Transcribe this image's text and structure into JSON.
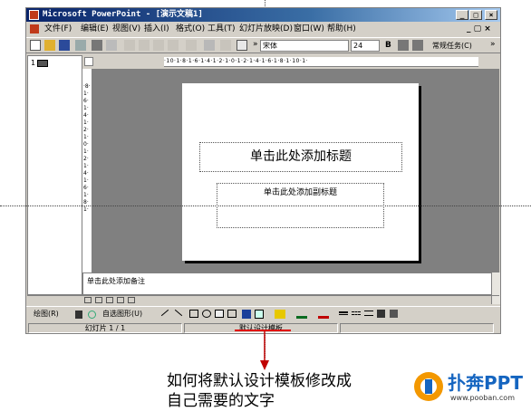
{
  "window": {
    "title": "Microsoft PowerPoint - [演示文稿1]",
    "min_label": "_",
    "max_label": "□",
    "close_label": "×"
  },
  "menu": {
    "items": [
      "文件(F)",
      "编辑(E)",
      "视图(V)",
      "插入(I)",
      "格式(O)",
      "工具(T)",
      "幻灯片放映(D)",
      "窗口(W)",
      "帮助(H)"
    ],
    "doc_controls": "_ ▢ ×"
  },
  "toolbar": {
    "font_name": "宋体",
    "font_size": "24",
    "bold_label": "B",
    "task_pane": "常规任务(C)",
    "more_label": "»"
  },
  "outline": {
    "slide_number": "1"
  },
  "ruler": {
    "horizontal": "·10·1·8·1·6·1·4·1·2·1·0·1·2·1·4·1·6·1·8·1·10·1·",
    "vertical": "·8·1·6·1·4·1·2·1·0·1·2·1·4·1·6·1·8·1·"
  },
  "slide": {
    "title_placeholder": "单击此处添加标题",
    "subtitle_placeholder": "单击此处添加副标题"
  },
  "notes": {
    "placeholder": "单击此处添加备注"
  },
  "drawing": {
    "draw_menu": "绘图(R)",
    "autoshapes": "自选图形(U)"
  },
  "status": {
    "slide_info": "幻灯片 1 / 1",
    "design": "默认设计模板"
  },
  "caption": {
    "line1": "如何将默认设计模板修改成",
    "line2": "自己需要的文字"
  },
  "brand": {
    "name": "扑奔PPT",
    "url": "www.pooban.com"
  },
  "colors": {
    "title_bar": "#0a246a",
    "highlight_underline": "#e00000",
    "arrow": "#c00000",
    "brand_orange": "#f39800",
    "brand_blue": "#1565c0"
  }
}
